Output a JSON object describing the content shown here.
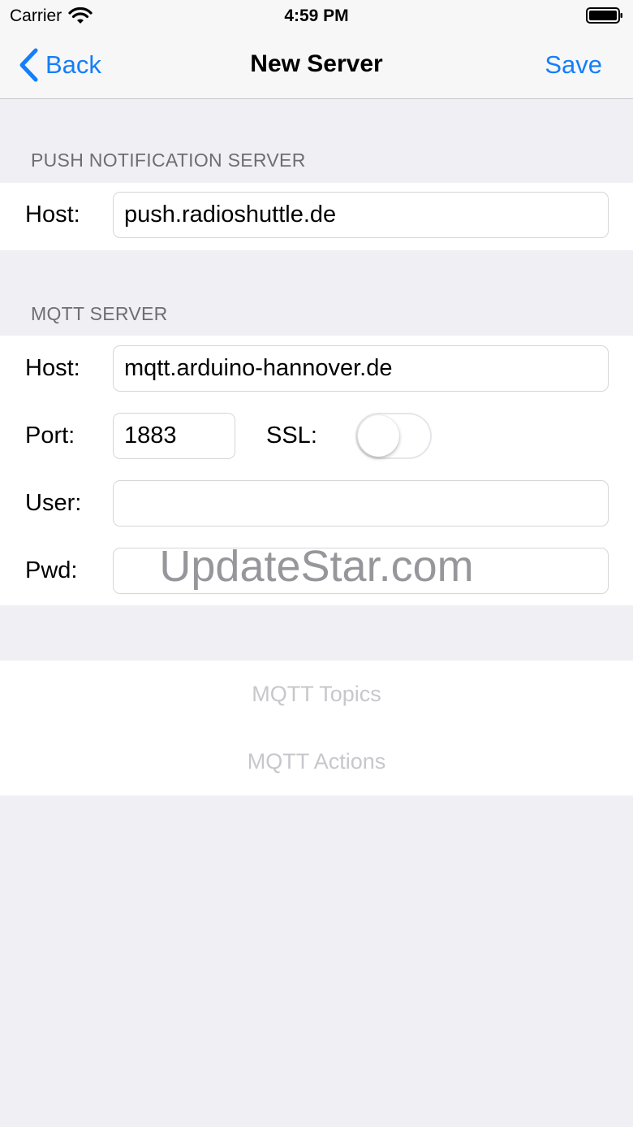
{
  "status_bar": {
    "carrier": "Carrier",
    "time": "4:59 PM",
    "wifi_icon": "wifi-icon",
    "battery_icon": "battery-icon"
  },
  "nav": {
    "back_label": "Back",
    "title": "New Server",
    "save_label": "Save",
    "accent_color": "#147efb"
  },
  "push_section": {
    "header": "PUSH NOTIFICATION SERVER",
    "host_label": "Host:",
    "host_value": "push.radioshuttle.de"
  },
  "mqtt_section": {
    "header": "MQTT SERVER",
    "host_label": "Host:",
    "host_value": "mqtt.arduino-hannover.de",
    "port_label": "Port:",
    "port_value": "1883",
    "ssl_label": "SSL:",
    "ssl_enabled": false,
    "user_label": "User:",
    "user_value": "",
    "pwd_label": "Pwd:",
    "pwd_value": ""
  },
  "links": {
    "topics": "MQTT Topics",
    "actions": "MQTT Actions"
  },
  "watermark": "UpdateStar.com"
}
